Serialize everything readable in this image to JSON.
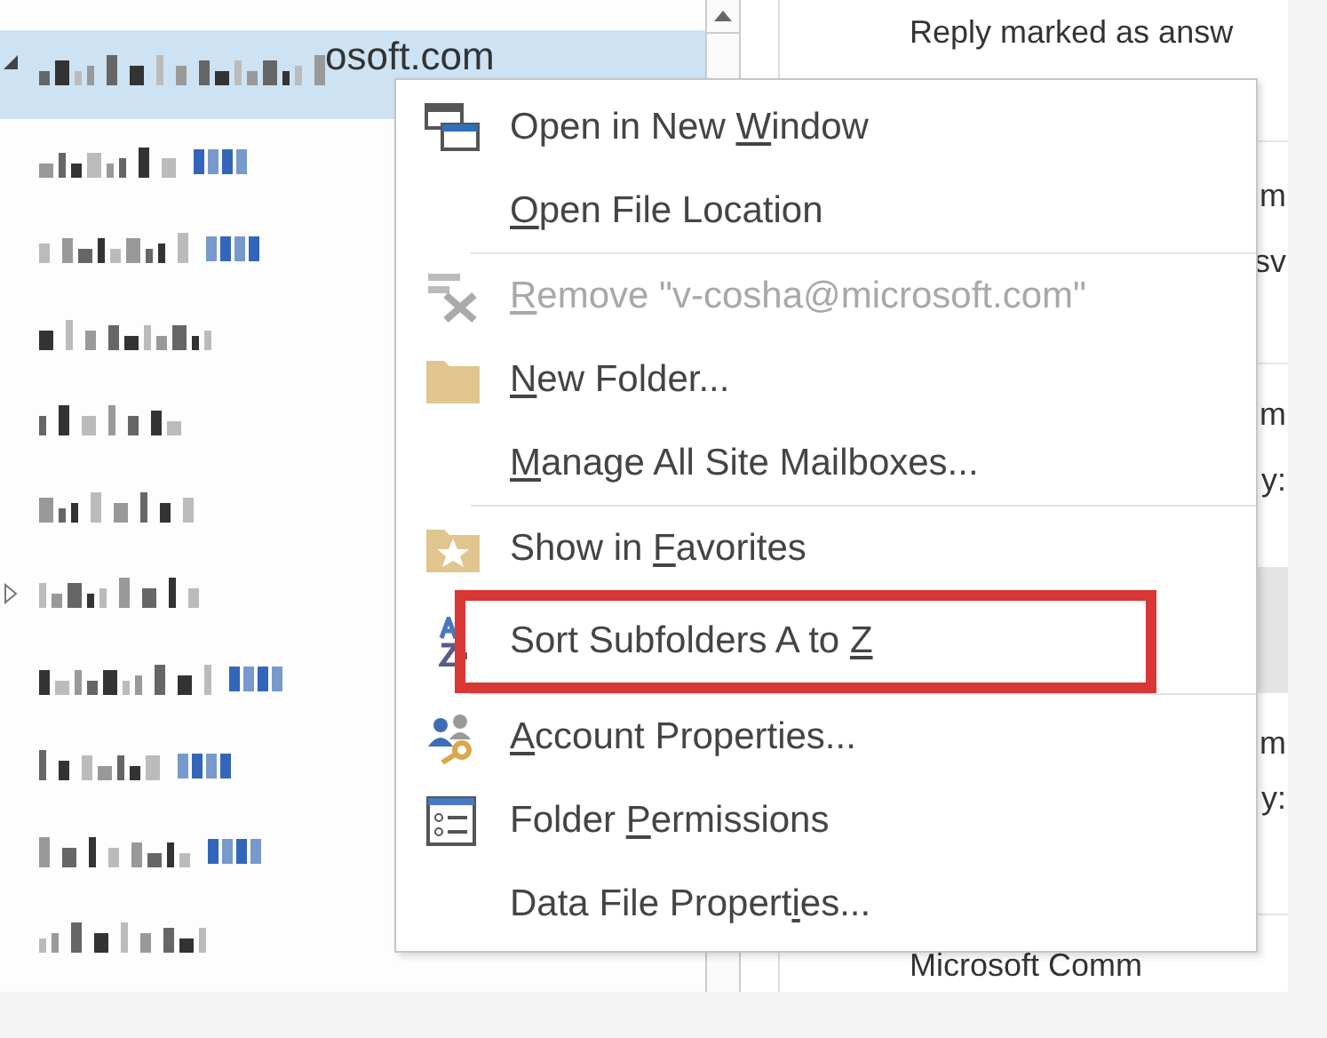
{
  "folders": [
    {
      "kind": "account",
      "selected": true,
      "expanded": true,
      "visible_text": "osoft.com"
    },
    {
      "kind": "with-count",
      "selected": false
    },
    {
      "kind": "with-count",
      "selected": false
    },
    {
      "kind": "plain",
      "selected": false
    },
    {
      "kind": "plain",
      "selected": false
    },
    {
      "kind": "plain",
      "selected": false
    },
    {
      "kind": "plain",
      "selected": false,
      "expanded": false
    },
    {
      "kind": "with-count",
      "selected": false
    },
    {
      "kind": "with-count",
      "selected": false
    },
    {
      "kind": "with-count",
      "selected": false
    },
    {
      "kind": "plain",
      "selected": false
    }
  ],
  "messages": [
    {
      "kind": "full",
      "selected": false,
      "lines": [
        "Reply marked as answ"
      ]
    },
    {
      "kind": "partial",
      "selected": false,
      "lines": [
        "m",
        "sv"
      ]
    },
    {
      "kind": "partial",
      "selected": false,
      "lines": [
        "m",
        "y:"
      ]
    },
    {
      "kind": "partial",
      "selected": true
    },
    {
      "kind": "partial",
      "selected": false,
      "lines": [
        "m",
        "y:"
      ]
    },
    {
      "kind": "full",
      "selected": false,
      "lines": [
        "Microsoft Comm"
      ]
    }
  ],
  "context_menu": {
    "groups": [
      [
        {
          "label": {
            "before": "Open in New ",
            "key": "W",
            "after": "indow"
          },
          "disabled": false,
          "highlighted": false
        },
        {
          "label": {
            "key": "O",
            "after": "pen File Location"
          },
          "disabled": false,
          "highlighted": false
        }
      ],
      [
        {
          "label": {
            "key": "R",
            "after": "emove \"v-cosha@microsoft.com\""
          },
          "disabled": true,
          "highlighted": false
        },
        {
          "label": {
            "key": "N",
            "after": "ew Folder..."
          },
          "disabled": false,
          "highlighted": false
        },
        {
          "label": {
            "key": "M",
            "after": "anage All Site Mailboxes..."
          },
          "disabled": false,
          "highlighted": false
        }
      ],
      [
        {
          "label": {
            "before": "Show in ",
            "key": "F",
            "after": "avorites"
          },
          "disabled": false,
          "highlighted": false
        },
        {
          "label": {
            "before": "Sort Subfolders A to ",
            "key": "Z"
          },
          "disabled": false,
          "highlighted": true
        }
      ],
      [
        {
          "label": {
            "key": "A",
            "after": "ccount Properties..."
          },
          "disabled": false,
          "highlighted": false
        },
        {
          "label": {
            "before": "Folder ",
            "key": "P",
            "after": "ermissions"
          },
          "disabled": false,
          "highlighted": false
        },
        {
          "label": {
            "before": "Data File Propert",
            "key": "i",
            "after": "es..."
          },
          "disabled": false,
          "highlighted": false
        }
      ]
    ]
  }
}
